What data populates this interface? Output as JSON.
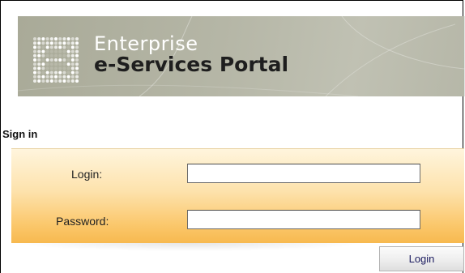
{
  "header": {
    "logo_mark": "e-logo-icon",
    "title_line1": "Enterprise",
    "title_line2": "e-Services Portal"
  },
  "signin": {
    "title": "Sign in",
    "login_label": "Login:",
    "login_value": "",
    "password_label": "Password:",
    "password_value": "",
    "submit_label": "Login"
  },
  "colors": {
    "banner": "#b5b6a6",
    "panel_top": "#fff5dd",
    "panel_bottom": "#f7b94f",
    "button_text": "#1a1a5e"
  }
}
